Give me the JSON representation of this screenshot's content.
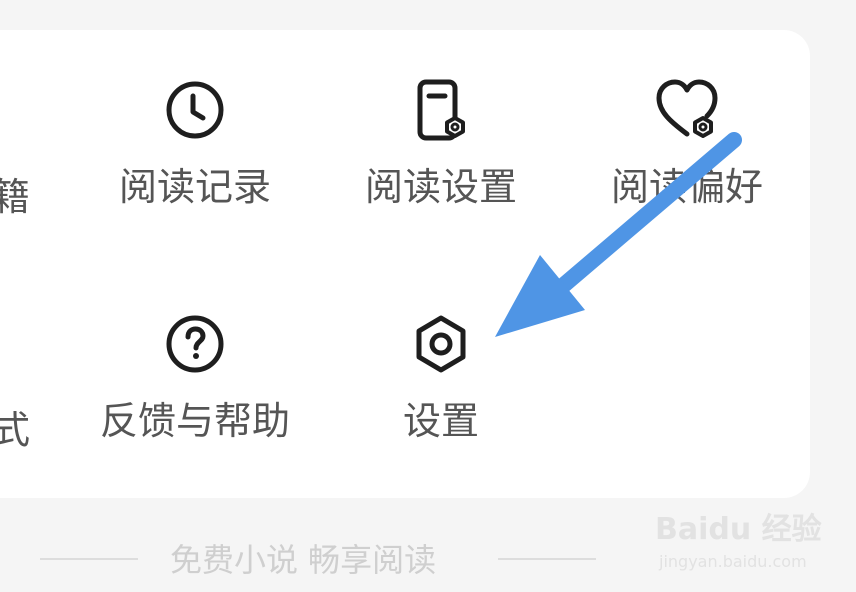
{
  "menu": {
    "row1": {
      "partial_label": "籍",
      "items": [
        {
          "label": "阅读记录",
          "icon": "clock-icon"
        },
        {
          "label": "阅读设置",
          "icon": "document-settings-icon"
        },
        {
          "label": "阅读偏好",
          "icon": "heart-settings-icon"
        }
      ]
    },
    "row2": {
      "partial_label": "式",
      "items": [
        {
          "label": "反馈与帮助",
          "icon": "question-circle-icon"
        },
        {
          "label": "设置",
          "icon": "hexagon-settings-icon"
        }
      ]
    }
  },
  "footer": {
    "slogan": "免费小说 畅享阅读"
  },
  "annotation": {
    "arrow_color": "#4f95e5",
    "icon": "arrow-icon"
  },
  "watermark": {
    "brand": "Baidu 经验",
    "url": "jingyan.baidu.com"
  }
}
